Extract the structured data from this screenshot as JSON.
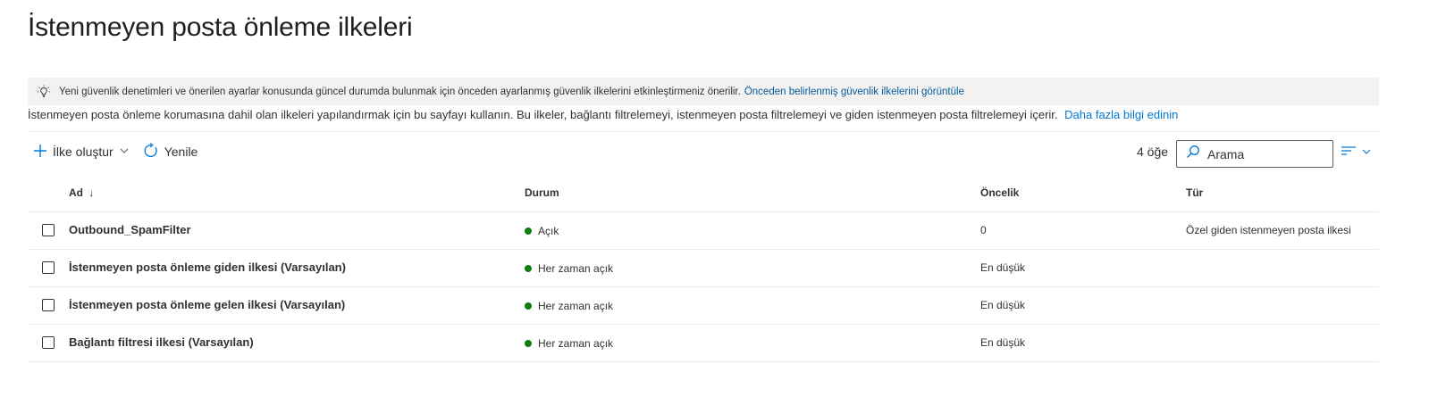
{
  "page": {
    "title": "İstenmeyen posta önleme ilkeleri"
  },
  "banner": {
    "icon": "lightbulb-icon",
    "text": "Yeni güvenlik denetimleri ve önerilen ayarlar konusunda güncel durumda bulunmak için önceden ayarlanmış güvenlik ilkelerini etkinleştirmeniz önerilir.",
    "link": "Önceden belirlenmiş güvenlik ilkelerini görüntüle"
  },
  "description": {
    "text": "İstenmeyen posta önleme korumasına dahil olan ilkeleri yapılandırmak için bu sayfayı kullanın. Bu ilkeler, bağlantı filtrelemeyi, istenmeyen posta filtrelemeyi ve giden istenmeyen posta filtrelemeyi içerir.",
    "link": "Daha fazla bilgi edinin"
  },
  "toolbar": {
    "create_label": "İlke oluştur",
    "refresh_label": "Yenile",
    "item_count": "4 öğe",
    "search_placeholder": "Arama"
  },
  "table": {
    "columns": [
      "Ad",
      "Durum",
      "Öncelik",
      "Tür"
    ],
    "sort_indicator": "↓",
    "rows": [
      {
        "name": "Outbound_SpamFilter",
        "status": "Açık",
        "priority": "0",
        "type": "Özel giden istenmeyen posta ilkesi"
      },
      {
        "name": "İstenmeyen posta önleme giden ilkesi (Varsayılan)",
        "status": "Her zaman açık",
        "priority": "En düşük",
        "type": ""
      },
      {
        "name": "İstenmeyen posta önleme gelen ilkesi (Varsayılan)",
        "status": "Her zaman açık",
        "priority": "En düşük",
        "type": ""
      },
      {
        "name": "Bağlantı filtresi ilkesi (Varsayılan)",
        "status": "Her zaman açık",
        "priority": "En düşük",
        "type": ""
      }
    ]
  },
  "colors": {
    "accent": "#0078d4",
    "status_on": "#107c10",
    "banner_bg": "#f3f2f1"
  }
}
